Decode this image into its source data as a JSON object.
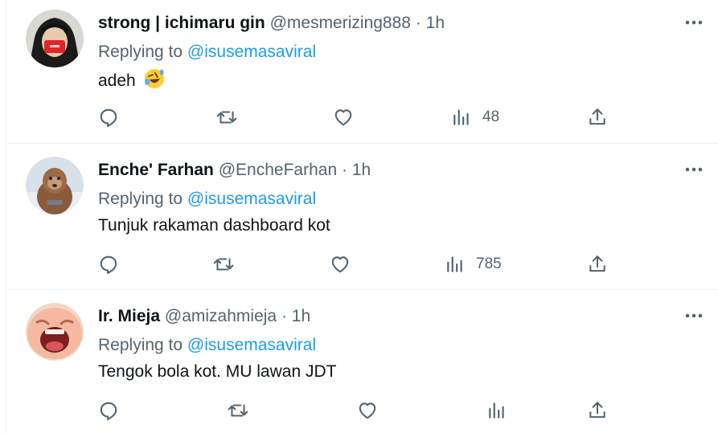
{
  "tweets": [
    {
      "name": "strong | ichimaru gin",
      "handle": "@mesmerizing888",
      "sep": "·",
      "time": "1h",
      "replying_prefix": "Replying to ",
      "replying_to": "@isusemasaviral",
      "text": "adeh",
      "emoji": "rolling-on-floor-laughing-emoji",
      "views": "48"
    },
    {
      "name": "Enche' Farhan",
      "handle": "@EncheFarhan",
      "sep": "·",
      "time": "1h",
      "replying_prefix": "Replying to ",
      "replying_to": "@isusemasaviral",
      "text": "Tunjuk rakaman dashboard kot",
      "views": "785"
    },
    {
      "name": "Ir. Mieja",
      "handle": "@amizahmieja",
      "sep": "·",
      "time": "1h",
      "replying_prefix": "Replying to ",
      "replying_to": "@isusemasaviral",
      "text": "Tengok bola kot. MU lawan JDT",
      "views": ""
    }
  ],
  "icons": [
    "more-icon",
    "reply-icon",
    "retweet-icon",
    "like-icon",
    "views-icon",
    "share-icon"
  ],
  "colors": {
    "text": "#0f1419",
    "secondary": "#536471",
    "link": "#1d9bf0",
    "divider": "#eff3f4"
  }
}
